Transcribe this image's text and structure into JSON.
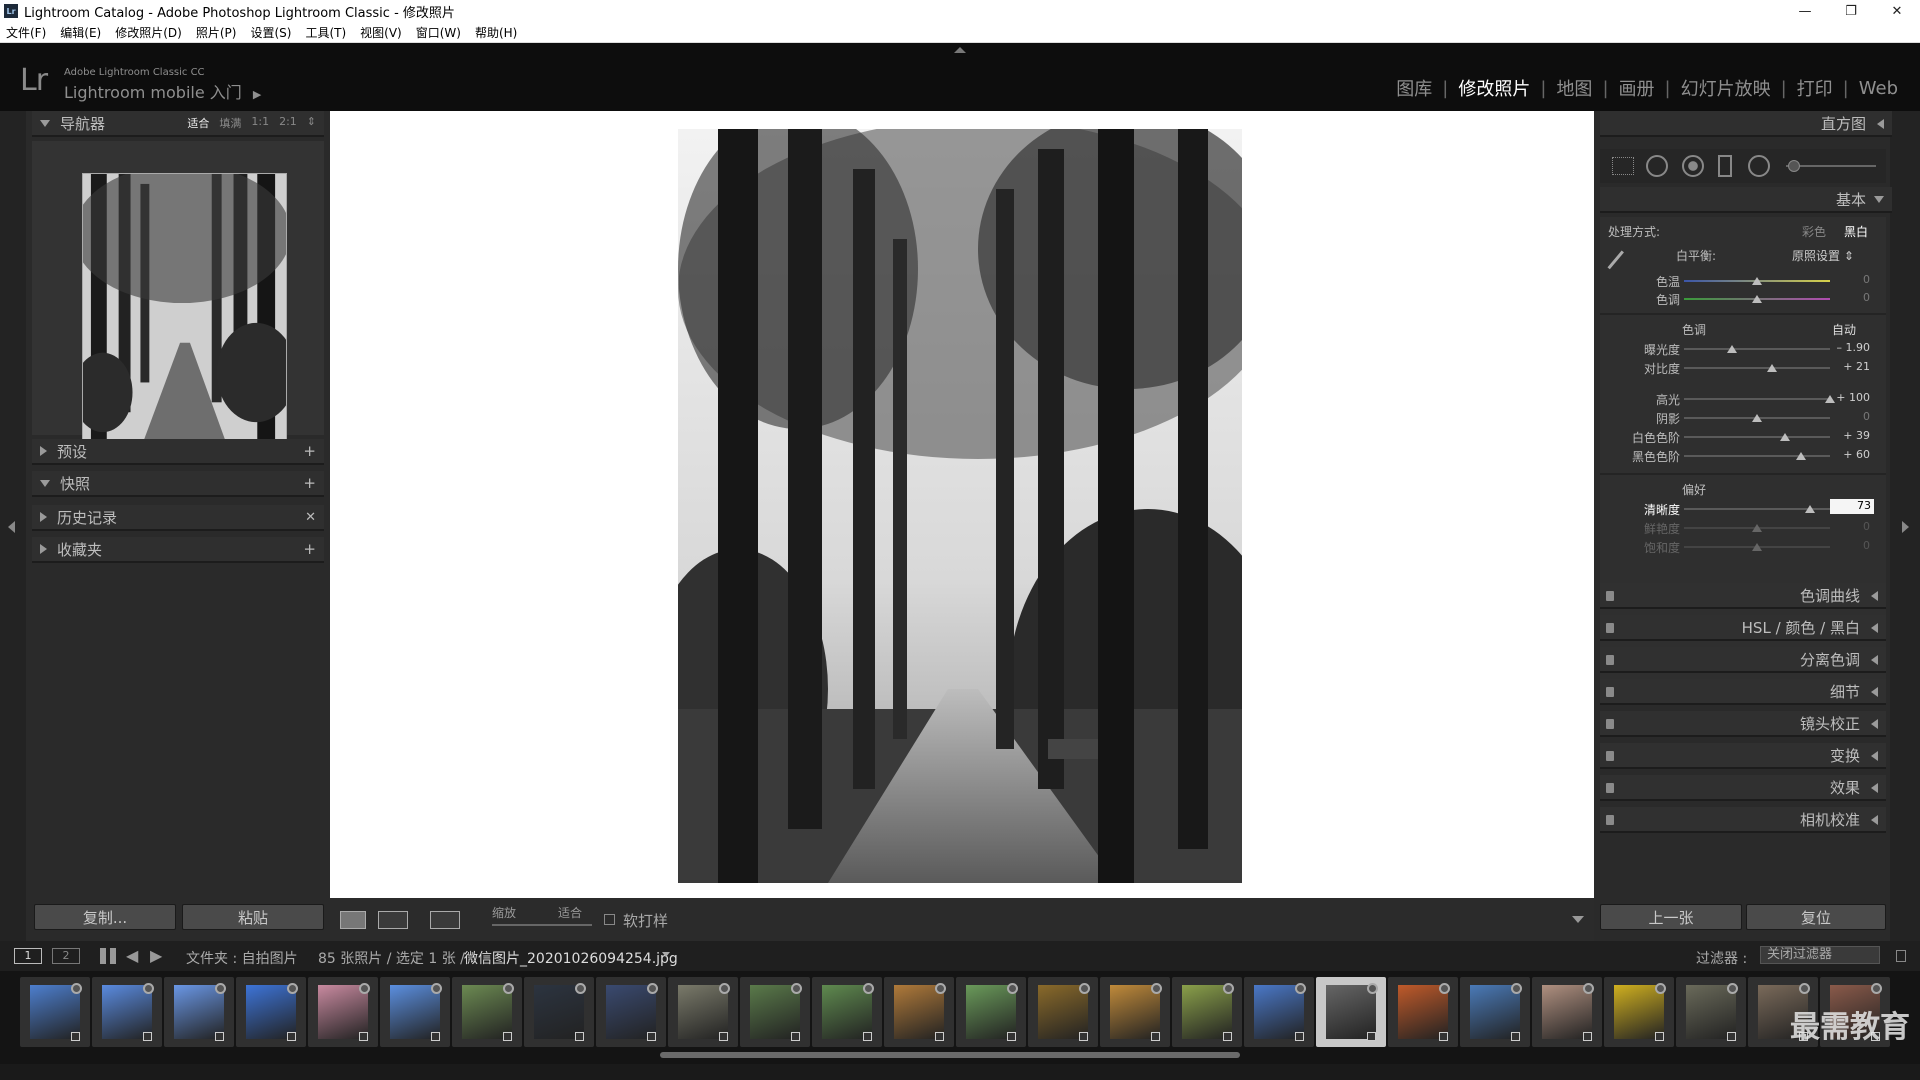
{
  "window": {
    "title": "Lightroom Catalog - Adobe Photoshop Lightroom Classic - 修改照片",
    "app_badge": "Lr",
    "min": "—",
    "max": "❐",
    "close": "✕"
  },
  "menu": [
    "文件(F)",
    "编辑(E)",
    "修改照片(D)",
    "照片(P)",
    "设置(S)",
    "工具(T)",
    "视图(V)",
    "窗口(W)",
    "帮助(H)"
  ],
  "identity": {
    "logo": "Lr",
    "line1": "Adobe Lightroom Classic CC",
    "line2": "Lightroom mobile 入门",
    "arrow": "▶"
  },
  "modules": {
    "items": [
      "图库",
      "修改照片",
      "地图",
      "画册",
      "幻灯片放映",
      "打印",
      "Web"
    ],
    "active": "修改照片"
  },
  "left": {
    "navigator": {
      "title": "导航器",
      "opts": [
        "适合",
        "填满",
        "1:1",
        "2:1"
      ],
      "active": "适合",
      "more": "⇕"
    },
    "presets": {
      "title": "预设",
      "action": "+"
    },
    "snapshots": {
      "title": "快照",
      "action": "+"
    },
    "history": {
      "title": "历史记录",
      "action": "✕"
    },
    "collections": {
      "title": "收藏夹",
      "action": "+"
    },
    "copy_btn": "复制...",
    "paste_btn": "粘贴"
  },
  "toolbar": {
    "zoom_label": "缩放",
    "zoom_value": "适合",
    "soft_proof": "软打样"
  },
  "right": {
    "histogram": "直方图",
    "basic": "基本",
    "treatment_label": "处理方式:",
    "treatment_color": "彩色",
    "treatment_bw": "黑白",
    "wb_label": "白平衡:",
    "wb_value": "原照设置 ⇕",
    "temp": {
      "label": "色温",
      "value": "0"
    },
    "tint": {
      "label": "色调",
      "value": "0"
    },
    "tone_label": "色调",
    "tone_auto": "自动",
    "exposure": {
      "label": "曝光度",
      "value": "– 1.90",
      "level": 0.33
    },
    "contrast": {
      "label": "对比度",
      "value": "+ 21",
      "level": 0.6
    },
    "highlights": {
      "label": "高光",
      "value": "+ 100",
      "level": 1.0
    },
    "shadows": {
      "label": "阴影",
      "value": "0",
      "level": 0.5
    },
    "whites": {
      "label": "白色色阶",
      "value": "+ 39",
      "level": 0.69
    },
    "blacks": {
      "label": "黑色色阶",
      "value": "+ 60",
      "level": 0.8
    },
    "presence_label": "偏好",
    "clarity": {
      "label": "清晰度",
      "value": "73",
      "level": 0.86
    },
    "vibrance": {
      "label": "鲜艳度",
      "value": "0"
    },
    "saturation": {
      "label": "饱和度",
      "value": "0"
    },
    "sections": [
      "色调曲线",
      "HSL  /  颜色  /  黑白",
      "分离色调",
      "细节",
      "镜头校正",
      "变换",
      "效果",
      "相机校准"
    ],
    "prev_btn": "上一张",
    "reset_btn": "复位"
  },
  "filmbar": {
    "screen1": "1",
    "screen2": "2",
    "path": "文件夹 : 自拍图片",
    "count": "85 张照片 / 选定 1 张 /",
    "filename": "微信图片_20201026094254.jpg",
    "filter_label": "过滤器 :",
    "filter_value": "关闭过滤器"
  },
  "watermark": "最需教育",
  "colors": {
    "accent_white": "#ffffff",
    "panel": "#2a2a2a"
  }
}
